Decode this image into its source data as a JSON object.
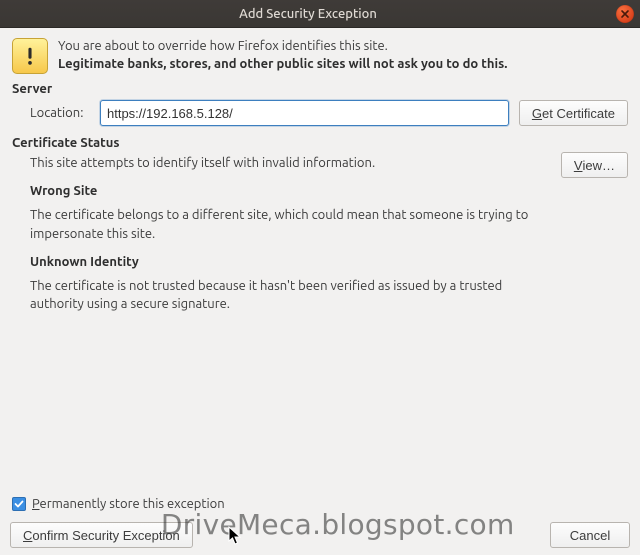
{
  "window": {
    "title": "Add Security Exception"
  },
  "info": {
    "line1": "You are about to override how Firefox identifies this site.",
    "line2": "Legitimate banks, stores, and other public sites will not ask you to do this."
  },
  "server": {
    "header": "Server",
    "location_label": "Location:",
    "location_value": "https://192.168.5.128/",
    "get_cert_prefix": "G",
    "get_cert_rest": "et Certificate"
  },
  "cert": {
    "header": "Certificate Status",
    "status_line": "This site attempts to identify itself with invalid information.",
    "view_prefix": "V",
    "view_rest": "iew…",
    "wrong_site_head": "Wrong Site",
    "wrong_site_body": "The certificate belongs to a different site, which could mean that someone is trying to impersonate this site.",
    "unknown_head": "Unknown Identity",
    "unknown_body": "The certificate is not trusted because it hasn't been verified as issued by a trusted authority using a secure signature."
  },
  "store": {
    "checked": true,
    "label_prefix": "P",
    "label_rest": "ermanently store this exception"
  },
  "footer": {
    "confirm_prefix": "C",
    "confirm_rest": "onfirm Security Exception",
    "cancel": "Cancel"
  },
  "watermark": "DriveMeca.blogspot.com"
}
